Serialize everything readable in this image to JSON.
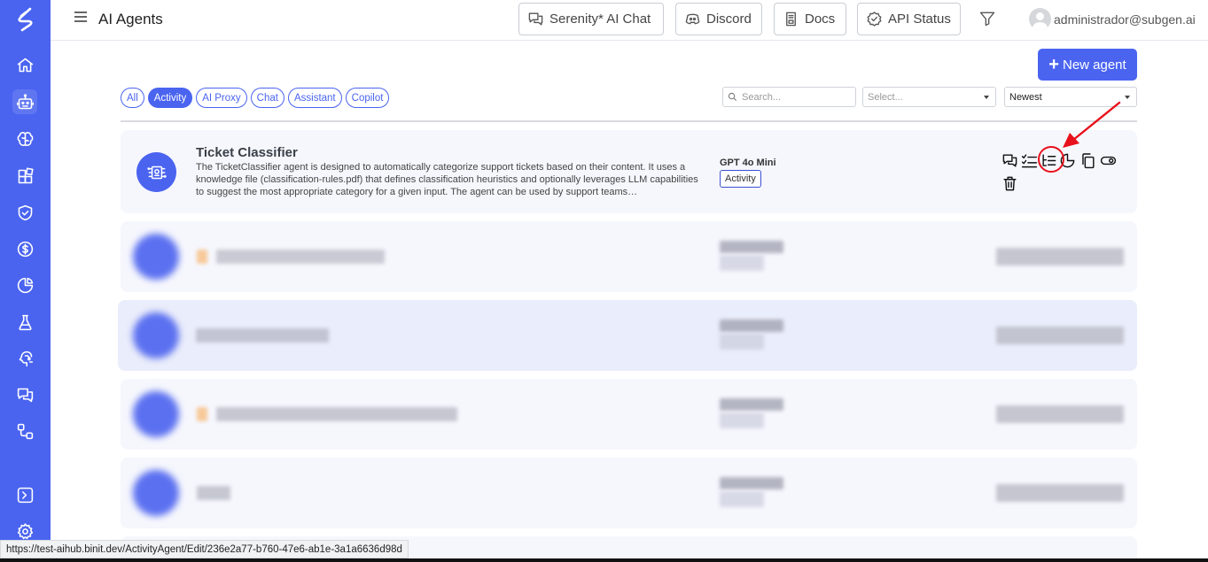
{
  "app": {
    "page_title": "AI Agents",
    "header_buttons": [
      {
        "label": "Serenity* AI Chat",
        "icon": "chat-icon"
      },
      {
        "label": "Discord",
        "icon": "discord-icon"
      },
      {
        "label": "Docs",
        "icon": "docs-icon"
      },
      {
        "label": "API Status",
        "icon": "badge-check-icon"
      }
    ],
    "user_email": "administrador@subgen.ai",
    "accent_color": "#4a64f0"
  },
  "sidebar": {
    "items": [
      {
        "icon": "home-icon"
      },
      {
        "icon": "robot-icon",
        "active": true
      },
      {
        "icon": "brain-icon"
      },
      {
        "icon": "blocks-icon"
      },
      {
        "icon": "shield-check-icon"
      },
      {
        "icon": "dollar-icon"
      },
      {
        "icon": "pie-chart-icon"
      },
      {
        "icon": "flask-icon"
      },
      {
        "icon": "head-circuit-icon"
      },
      {
        "icon": "messages-icon"
      },
      {
        "icon": "workflow-icon"
      },
      {
        "icon": "terminal-icon"
      },
      {
        "icon": "settings-icon"
      }
    ]
  },
  "toolbar": {
    "new_agent_label": "New agent",
    "filters": [
      "All",
      "Activity",
      "AI Proxy",
      "Chat",
      "Assistant",
      "Copilot"
    ],
    "active_filter": "Activity",
    "search_placeholder": "Search...",
    "select_placeholder": "Select...",
    "sort_value": "Newest"
  },
  "agents": [
    {
      "name": "Ticket Classifier",
      "description": "The TicketClassifier agent is designed to automatically categorize support tickets based on their content. It uses a knowledge file (classification-rules.pdf) that defines classification heuristics and optionally leverages LLM capabilities to suggest the most appropriate category for a given input. The agent can be used by support teams…",
      "model": "GPT 4o Mini",
      "type": "Activity",
      "actions": [
        "chat-icon",
        "checklist-icon",
        "list-indent-icon",
        "pie-chart-icon",
        "copy-icon",
        "toggle-icon",
        "trash-icon"
      ]
    }
  ],
  "annotation": {
    "highlighted_action": "list-indent-icon",
    "color": "#e8101a"
  },
  "statusbar": {
    "url": "https://test-aihub.binit.dev/ActivityAgent/Edit/236e2a77-b760-47e6-ab1e-3a1a6636d98d"
  }
}
